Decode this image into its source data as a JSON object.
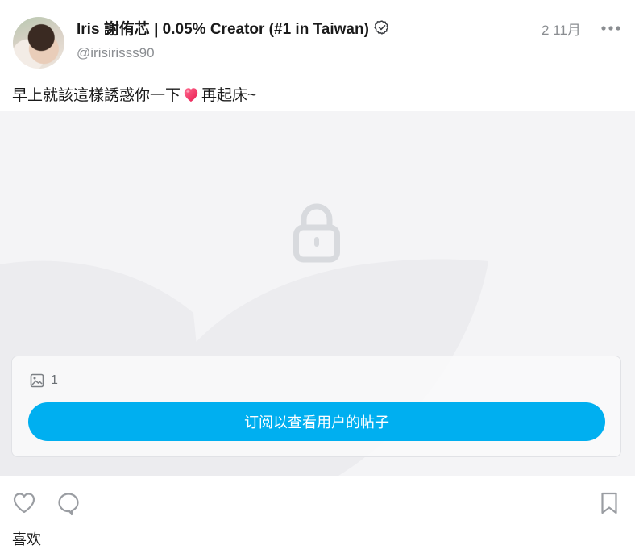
{
  "post": {
    "author": {
      "name": "Iris 謝侑芯 | 0.05% Creator (#1 in Taiwan)",
      "handle": "@irisirisss90",
      "verified": true
    },
    "date": "2 11月",
    "caption_before_emoji": "早上就該這樣誘惑你一下",
    "caption_emoji": "heart-emoji",
    "caption_after_emoji": "再起床~",
    "media": {
      "locked": true,
      "image_count": "1",
      "subscribe_label": "订阅以查看用户的帖子"
    },
    "likes_label": "喜欢"
  },
  "icons": {
    "more": "more-horizontal-icon",
    "lock": "lock-icon",
    "image": "image-icon",
    "like": "heart-outline-icon",
    "comment": "comment-bubble-icon",
    "bookmark": "bookmark-icon",
    "verified": "verified-badge-icon"
  },
  "colors": {
    "accent": "#00aff0",
    "muted_text": "#8a8d91",
    "media_background": "#f4f4f6",
    "emoji_heart": "#ff3b6b"
  }
}
